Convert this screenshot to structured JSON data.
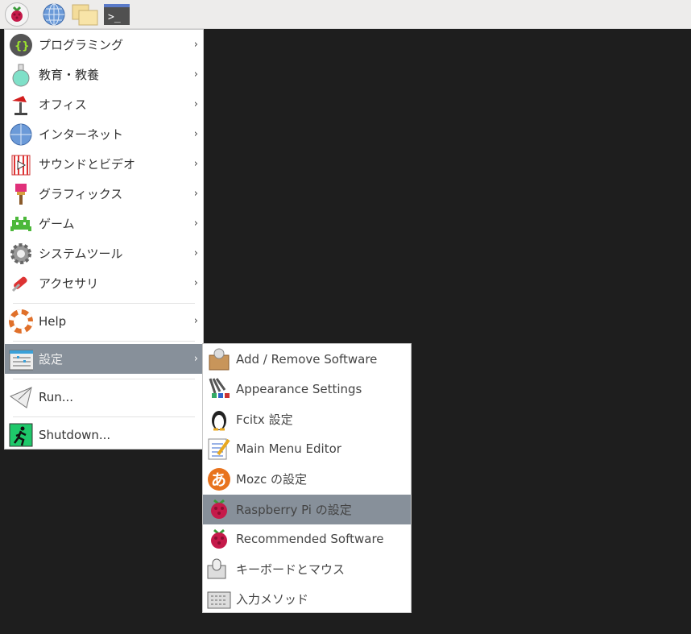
{
  "taskbar": {
    "items": [
      "raspberry-menu",
      "web-browser",
      "file-manager",
      "terminal"
    ],
    "terminal_glyph": ">_"
  },
  "main_menu": {
    "items": [
      {
        "label": "プログラミング",
        "icon": "programming-icon"
      },
      {
        "label": "教育・教養",
        "icon": "education-icon"
      },
      {
        "label": "オフィス",
        "icon": "office-icon"
      },
      {
        "label": "インターネット",
        "icon": "internet-icon"
      },
      {
        "label": "サウンドとビデオ",
        "icon": "sound-video-icon"
      },
      {
        "label": "グラフィックス",
        "icon": "graphics-icon"
      },
      {
        "label": "ゲーム",
        "icon": "games-icon"
      },
      {
        "label": "システムツール",
        "icon": "system-tools-icon"
      },
      {
        "label": "アクセサリ",
        "icon": "accessories-icon"
      },
      {
        "label": "Help",
        "icon": "help-icon"
      },
      {
        "label": "設定",
        "icon": "preferences-icon"
      },
      {
        "label": "Run...",
        "icon": "run-icon"
      },
      {
        "label": "Shutdown...",
        "icon": "shutdown-icon"
      }
    ],
    "programming_glyph": "{}"
  },
  "sub_menu": {
    "items": [
      {
        "label": "Add / Remove Software"
      },
      {
        "label": "Appearance Settings"
      },
      {
        "label": "Fcitx 設定"
      },
      {
        "label": "Main Menu Editor"
      },
      {
        "label": "Mozc の設定",
        "glyph": "あ"
      },
      {
        "label": "Raspberry Pi の設定"
      },
      {
        "label": "Recommended Software"
      },
      {
        "label": "キーボードとマウス"
      },
      {
        "label": "入力メソッド"
      }
    ]
  },
  "colors": {
    "selected": "#87909a",
    "desktop": "#1e1e1e"
  }
}
